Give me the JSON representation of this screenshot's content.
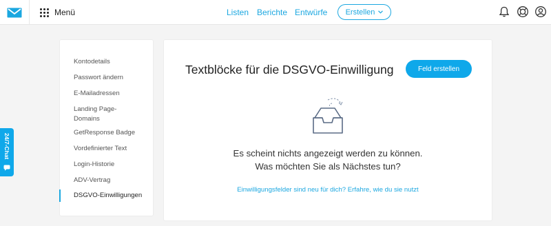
{
  "header": {
    "logo_icon": "envelope-icon",
    "menu_icon": "grid-dots-icon",
    "menu_label": "Menü",
    "nav": [
      "Listen",
      "Berichte",
      "Entwürfe"
    ],
    "create_label": "Erstellen",
    "icons": [
      "bell-icon",
      "lifebuoy-icon",
      "user-icon"
    ]
  },
  "sidebar": {
    "items": [
      {
        "label": "Kontodetails"
      },
      {
        "label": "Passwort ändern"
      },
      {
        "label": "E-Mailadressen"
      },
      {
        "label": "Landing Page-\nDomains"
      },
      {
        "label": "GetResponse Badge"
      },
      {
        "label": "Vordefinierter Text"
      },
      {
        "label": "Login-Historie"
      },
      {
        "label": "ADV-Vertrag"
      },
      {
        "label": "DSGVO-Einwilligungen"
      }
    ],
    "active_index": 8
  },
  "main": {
    "title": "Textblöcke für die DSGVO-Einwilligung",
    "create_field_label": "Feld erstellen",
    "empty_icon": "empty-tray-icon",
    "empty_line1": "Es scheint nichts angezeigt werden zu können.",
    "empty_line2": "Was möchten Sie als Nächstes tun?",
    "info_link": "Einwilligungsfelder sind neu für dich? Erfahre, wie du sie nutzt"
  },
  "chat": {
    "label": "24/7-Chat",
    "icon": "chat-bubble-icon"
  },
  "colors": {
    "accent": "#1ba7e0",
    "button": "#0fa8ea",
    "background": "#f4f4f4"
  }
}
